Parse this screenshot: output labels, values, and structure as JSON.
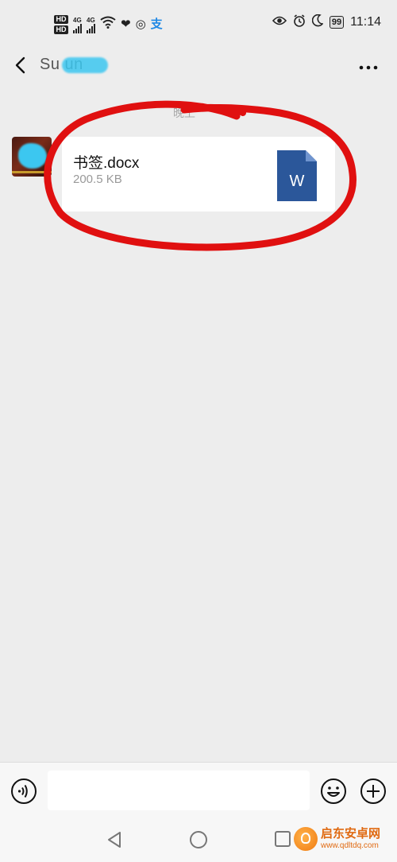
{
  "status_bar": {
    "hd1": "HD",
    "hd2": "HD",
    "sig1_label": "4G",
    "sig2_label": "4G",
    "icons": [
      "wifi-icon",
      "heart-pulse-icon",
      "nfc-icon",
      "payment-icon",
      "eye-icon",
      "alarm-icon",
      "moon-icon"
    ],
    "battery": "99",
    "time": "11:14"
  },
  "header": {
    "title": "Su          un",
    "more_label": "⋮"
  },
  "chat": {
    "timestamp": "晚上",
    "file": {
      "name": "书签.docx",
      "size": "200.5 KB",
      "icon_letter": "W",
      "icon_color": "#2b579a"
    }
  },
  "input_bar": {
    "text_value": "",
    "placeholder": ""
  },
  "annotation_color": "#e01010",
  "watermark": {
    "name": "启东安卓网",
    "url": "www.qdltdq.com"
  }
}
